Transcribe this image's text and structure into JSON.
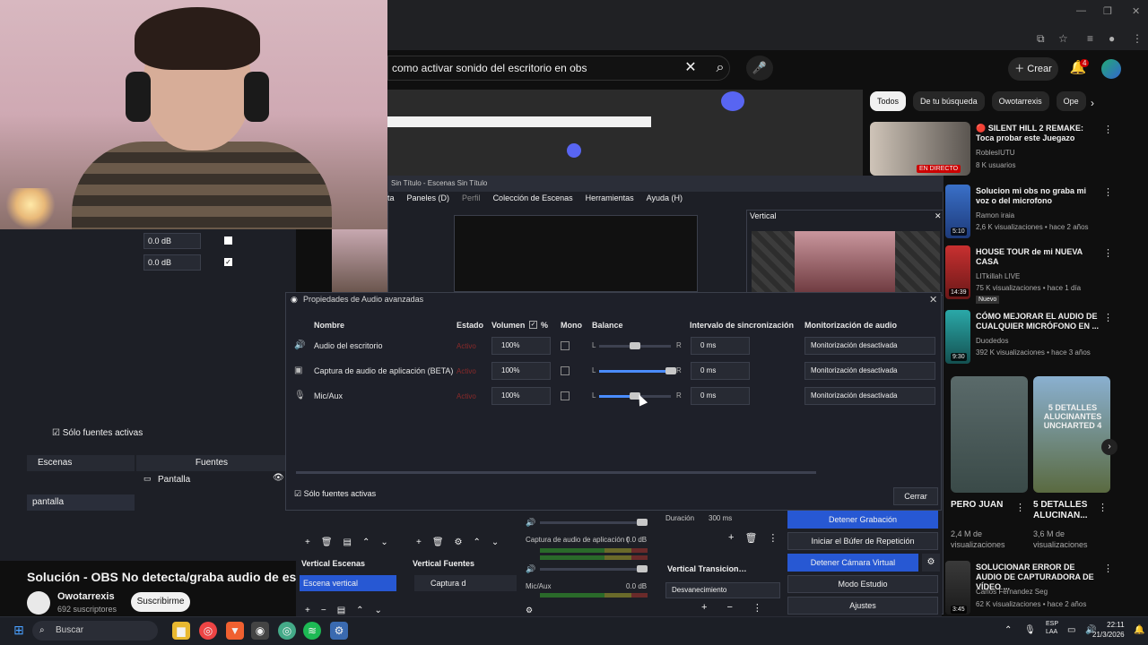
{
  "browser": {
    "search_query": "como activar sonido del escritorio en obs",
    "create_label": "Crear",
    "notif_count": "4"
  },
  "filters": [
    "Todos",
    "De tu búsqueda",
    "Owotarrexis",
    "Ope"
  ],
  "obs_window": {
    "title": "Sin Título - Escenas Sin Título",
    "menu": [
      "ta",
      "Paneles (D)",
      "Perfil",
      "Colección de Escenas",
      "Herramientas",
      "Ayuda (H)"
    ],
    "vertical_title": "Vertical"
  },
  "left_pane": {
    "db1": "0.0 dB",
    "db2": "0.0 dB",
    "only_active": "Sólo fuentes activas",
    "scenes_header": "Escenas",
    "sources_header": "Fuentes",
    "scene_item": "pantalla",
    "source_item": "Pantalla"
  },
  "dialog": {
    "title": "Propiedades de Audio avanzadas",
    "columns": {
      "name": "Nombre",
      "state": "Estado",
      "volume": "Volumen",
      "percent": "%",
      "mono": "Mono",
      "balance": "Balance",
      "sync": "Intervalo de sincronización",
      "monitoring": "Monitorización de audio"
    },
    "rows": [
      {
        "name": "Audio del escritorio",
        "state": "Activo",
        "volume": "100%",
        "sync": "0 ms",
        "monitoring": "Monitorización desactivada",
        "balance": 0.5
      },
      {
        "name": "Captura de audio de aplicación (BETA)",
        "state": "Activo",
        "volume": "100%",
        "sync": "0 ms",
        "monitoring": "Monitorización desactivada",
        "balance": 1.0
      },
      {
        "name": "Mic/Aux",
        "state": "Activo",
        "volume": "100%",
        "sync": "0 ms",
        "monitoring": "Monitorización desactivada",
        "balance": 0.5
      }
    ],
    "balance_l": "L",
    "balance_r": "R",
    "only_active": "Sólo fuentes activas",
    "close_label": "Cerrar"
  },
  "docks": {
    "vertical_scenes": "Vertical Escenas",
    "vertical_sources": "Vertical Fuentes",
    "scene_vertical_item": "Escena vertical",
    "source_item": "Captura d",
    "mixer_label1": "Captura de audio de aplicación (",
    "mixer_label1_db": "0.0 dB",
    "mixer_label2": "Mic/Aux",
    "mixer_label2_db": "0.0 dB",
    "duration_label": "Duración",
    "duration_val": "300 ms",
    "transition_title": "Vertical Transicion…",
    "transition_select": "Desvanecimiento",
    "controls": [
      "Detener Grabación",
      "Iniciar el Búfer de Repetición",
      "Detener Cámara Virtual",
      "Modo Estudio",
      "Ajustes"
    ]
  },
  "video": {
    "title": "Solución - OBS No detecta/graba audio de escritorio",
    "channel": "Owotarrexis",
    "subs": "692 suscriptores",
    "subscribe": "Suscribirme"
  },
  "related": [
    {
      "title": "🔴 SILENT HILL 2 REMAKE: Toca probar este Juegazo",
      "channel": "RoblesIUTU",
      "meta": "8 K usuarios",
      "badge": "EN DIRECTO"
    },
    {
      "title": "Solucion mi obs no graba mi voz o del microfono",
      "channel": "Ramon iraia",
      "meta": "2,6 K visualizaciones • hace 2 años",
      "badge": "5:10"
    },
    {
      "title": "HOUSE TOUR de mi NUEVA CASA",
      "channel": "LITkillah LIVE",
      "meta": "75 K visualizaciones • hace 1 día",
      "badge": "14:39",
      "tag": "Nuevo"
    },
    {
      "title": "CÓMO MEJORAR EL AUDIO DE CUALQUIER MICRÓFONO EN ...",
      "channel": "Duodedos",
      "meta": "392 K visualizaciones • hace 3 años",
      "badge": "9:30"
    }
  ],
  "shorts": [
    {
      "title": "PERO JUAN",
      "meta": "2,4 M de visualizaciones"
    },
    {
      "title": "5 DETALLES ALUCINAN...",
      "meta": "3,6 M de visualizaciones",
      "overlay": "5 DETALLES ALUCINANTES UNCHARTED 4"
    }
  ],
  "bottom_related": {
    "title": "SOLUCIONAR ERROR DE AUDIO DE CAPTURADORA DE VÍDEO ...",
    "channel": "Carlos Fernandez Seg",
    "meta": "62 K visualizaciones • hace 2 años",
    "badge": "3:45"
  },
  "taskbar": {
    "search": "Buscar",
    "lang1": "ESP",
    "lang2": "LAA",
    "time": "22:11",
    "date": "21/3/2026"
  }
}
